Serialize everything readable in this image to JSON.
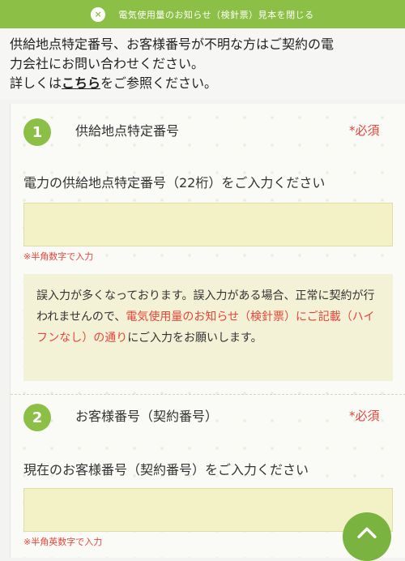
{
  "banner": {
    "close_icon": "×",
    "text": "電気使用量のお知らせ（検針票）見本を閉じる"
  },
  "intro": {
    "line1": "供給地点特定番号、お客様番号が不明な方はご契約の電",
    "line2": "力会社にお問い合わせください。",
    "line3_pre": "詳しくは",
    "line3_link": "こちら",
    "line3_post": "をご参照ください。"
  },
  "section1": {
    "number": "1",
    "title": "供給地点特定番号",
    "required": "*必須",
    "label": "電力の供給地点特定番号（22桁）をご入力ください",
    "input_value": "",
    "note": "※半角数字で入力",
    "warning_pre": "誤入力が多くなっております。誤入力がある場合、正常に契約が行われませんので、",
    "warning_red": "電気使用量のお知らせ（検針票）にご記載（ハイフンなし）の通り",
    "warning_post": "にご入力をお願いします。"
  },
  "section2": {
    "number": "2",
    "title": "お客様番号（契約番号）",
    "required": "*必須",
    "label": "現在のお客様番号（契約番号）をご入力ください",
    "input_value": "",
    "note": "※半角英数字で入力"
  },
  "scroll_top_icon": "chevron-up-icon",
  "colors": {
    "accent": "#8cbf45",
    "required": "#e2473c",
    "input_bg": "#f3f2c7"
  }
}
